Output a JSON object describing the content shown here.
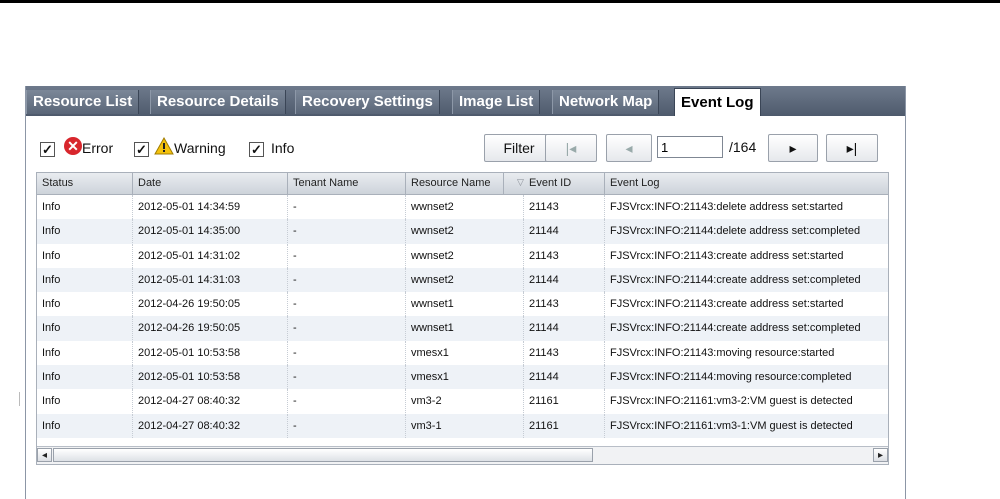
{
  "tabs": [
    {
      "label": "Resource List",
      "active": false
    },
    {
      "label": "Resource Details",
      "active": false
    },
    {
      "label": "Recovery Settings",
      "active": false
    },
    {
      "label": "Image List",
      "active": false
    },
    {
      "label": "Network Map",
      "active": false
    },
    {
      "label": "Event Log",
      "active": true
    }
  ],
  "filters": {
    "error": {
      "label": "Error",
      "checked": true
    },
    "warning": {
      "label": "Warning",
      "checked": true
    },
    "info": {
      "label": "Info",
      "checked": true
    },
    "filter_button": "Filter"
  },
  "pager": {
    "first_icon": "first-page-icon",
    "prev_icon": "prev-page-icon",
    "next_icon": "next-page-icon",
    "last_icon": "last-page-icon",
    "current_page": "1",
    "total": "/164"
  },
  "table": {
    "columns": [
      "Status",
      "Date",
      "Tenant Name",
      "Resource Name",
      "Event ID",
      "Event Log"
    ],
    "rows": [
      [
        "Info",
        "2012-05-01 14:34:59",
        "-",
        "wwnset2",
        "21143",
        "FJSVrcx:INFO:21143:delete address set:started"
      ],
      [
        "Info",
        "2012-05-01 14:35:00",
        "-",
        "wwnset2",
        "21144",
        "FJSVrcx:INFO:21144:delete address set:completed"
      ],
      [
        "Info",
        "2012-05-01 14:31:02",
        "-",
        "wwnset2",
        "21143",
        "FJSVrcx:INFO:21143:create address set:started"
      ],
      [
        "Info",
        "2012-05-01 14:31:03",
        "-",
        "wwnset2",
        "21144",
        "FJSVrcx:INFO:21144:create address set:completed"
      ],
      [
        "Info",
        "2012-04-26 19:50:05",
        "-",
        "wwnset1",
        "21143",
        "FJSVrcx:INFO:21143:create address set:started"
      ],
      [
        "Info",
        "2012-04-26 19:50:05",
        "-",
        "wwnset1",
        "21144",
        "FJSVrcx:INFO:21144:create address set:completed"
      ],
      [
        "Info",
        "2012-05-01 10:53:58",
        "-",
        "vmesx1",
        "21143",
        "FJSVrcx:INFO:21143:moving resource:started"
      ],
      [
        "Info",
        "2012-05-01 10:53:58",
        "-",
        "vmesx1",
        "21144",
        "FJSVrcx:INFO:21144:moving resource:completed"
      ],
      [
        "Info",
        "2012-04-27 08:40:32",
        "-",
        "vm3-2",
        "21161",
        "FJSVrcx:INFO:21161:vm3-2:VM guest is detected"
      ],
      [
        "Info",
        "2012-04-27 08:40:32",
        "-",
        "vm3-1",
        "21161",
        "FJSVrcx:INFO:21161:vm3-1:VM guest is detected"
      ]
    ]
  },
  "colors": {
    "tabbar": "#5a6678",
    "error_icon": "#d8262c",
    "warning_icon": "#f4c20d",
    "row_alt": "#eef2f7"
  }
}
